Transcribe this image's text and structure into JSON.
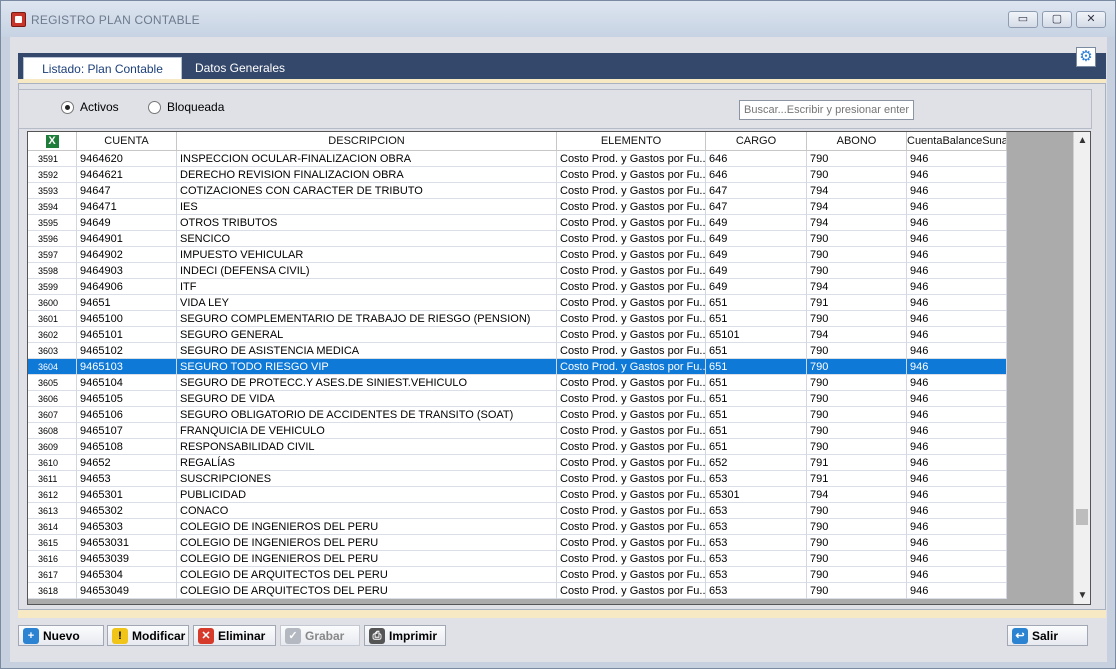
{
  "window": {
    "title": "REGISTRO PLAN CONTABLE",
    "controls": [
      "▭",
      "▢",
      "✕"
    ]
  },
  "tabs": [
    "Listado: Plan Contable",
    "Datos Generales"
  ],
  "filters": {
    "option1": "Activos",
    "option2": "Bloqueada",
    "search_placeholder": "Buscar...Escribir y presionar enter"
  },
  "grid": {
    "columns": [
      "",
      "CUENTA",
      "DESCRIPCION",
      "ELEMENTO",
      "CARGO",
      "ABONO",
      "CuentaBalanceSunat"
    ],
    "rows": [
      [
        "3591",
        "9464620",
        "INSPECCION OCULAR-FINALIZACION OBRA",
        "Costo Prod. y Gastos por Fu...",
        "646",
        "790",
        "946"
      ],
      [
        "3592",
        "9464621",
        "DERECHO REVISION FINALIZACION OBRA",
        "Costo Prod. y Gastos por Fu...",
        "646",
        "790",
        "946"
      ],
      [
        "3593",
        "94647",
        "COTIZACIONES CON CARACTER DE TRIBUTO",
        "Costo Prod. y Gastos por Fu...",
        "647",
        "794",
        "946"
      ],
      [
        "3594",
        "946471",
        "IES",
        "Costo Prod. y Gastos por Fu...",
        "647",
        "794",
        "946"
      ],
      [
        "3595",
        "94649",
        "OTROS TRIBUTOS",
        "Costo Prod. y Gastos por Fu...",
        "649",
        "794",
        "946"
      ],
      [
        "3596",
        "9464901",
        "SENCICO",
        "Costo Prod. y Gastos por Fu...",
        "649",
        "790",
        "946"
      ],
      [
        "3597",
        "9464902",
        "IMPUESTO VEHICULAR",
        "Costo Prod. y Gastos por Fu...",
        "649",
        "790",
        "946"
      ],
      [
        "3598",
        "9464903",
        "INDECI (DEFENSA CIVIL)",
        "Costo Prod. y Gastos por Fu...",
        "649",
        "790",
        "946"
      ],
      [
        "3599",
        "9464906",
        "ITF",
        "Costo Prod. y Gastos por Fu...",
        "649",
        "794",
        "946"
      ],
      [
        "3600",
        "94651",
        "VIDA LEY",
        "Costo Prod. y Gastos por Fu...",
        "651",
        "791",
        "946"
      ],
      [
        "3601",
        "9465100",
        "SEGURO COMPLEMENTARIO DE TRABAJO DE RIESGO (PENSION)",
        "Costo Prod. y Gastos por Fu...",
        "651",
        "790",
        "946"
      ],
      [
        "3602",
        "9465101",
        "SEGURO GENERAL",
        "Costo Prod. y Gastos por Fu...",
        "65101",
        "794",
        "946"
      ],
      [
        "3603",
        "9465102",
        "SEGURO DE ASISTENCIA MEDICA",
        "Costo Prod. y Gastos por Fu...",
        "651",
        "790",
        "946"
      ],
      [
        "3604",
        "9465103",
        "SEGURO TODO RIESGO VIP",
        "Costo Prod. y Gastos por Fu...",
        "651",
        "790",
        "946"
      ],
      [
        "3605",
        "9465104",
        "SEGURO DE PROTECC.Y ASES.DE SINIEST.VEHICULO",
        "Costo Prod. y Gastos por Fu...",
        "651",
        "790",
        "946"
      ],
      [
        "3606",
        "9465105",
        "SEGURO DE VIDA",
        "Costo Prod. y Gastos por Fu...",
        "651",
        "790",
        "946"
      ],
      [
        "3607",
        "9465106",
        "SEGURO OBLIGATORIO DE ACCIDENTES DE TRANSITO (SOAT)",
        "Costo Prod. y Gastos por Fu...",
        "651",
        "790",
        "946"
      ],
      [
        "3608",
        "9465107",
        "FRANQUICIA DE VEHICULO",
        "Costo Prod. y Gastos por Fu...",
        "651",
        "790",
        "946"
      ],
      [
        "3609",
        "9465108",
        "RESPONSABILIDAD CIVIL",
        "Costo Prod. y Gastos por Fu...",
        "651",
        "790",
        "946"
      ],
      [
        "3610",
        "94652",
        "REGALÍAS",
        "Costo Prod. y Gastos por Fu...",
        "652",
        "791",
        "946"
      ],
      [
        "3611",
        "94653",
        "SUSCRIPCIONES",
        "Costo Prod. y Gastos por Fu...",
        "653",
        "791",
        "946"
      ],
      [
        "3612",
        "9465301",
        "PUBLICIDAD",
        "Costo Prod. y Gastos por Fu...",
        "65301",
        "794",
        "946"
      ],
      [
        "3613",
        "9465302",
        "CONACO",
        "Costo Prod. y Gastos por Fu...",
        "653",
        "790",
        "946"
      ],
      [
        "3614",
        "9465303",
        "COLEGIO DE INGENIEROS DEL PERU",
        "Costo Prod. y Gastos por Fu...",
        "653",
        "790",
        "946"
      ],
      [
        "3615",
        "94653031",
        "COLEGIO DE INGENIEROS DEL PERU",
        "Costo Prod. y Gastos por Fu...",
        "653",
        "790",
        "946"
      ],
      [
        "3616",
        "94653039",
        "COLEGIO DE INGENIEROS DEL PERU",
        "Costo Prod. y Gastos por Fu...",
        "653",
        "790",
        "946"
      ],
      [
        "3617",
        "9465304",
        "COLEGIO DE ARQUITECTOS DEL PERU",
        "Costo Prod. y Gastos por Fu...",
        "653",
        "790",
        "946"
      ],
      [
        "3618",
        "94653049",
        "COLEGIO DE ARQUITECTOS DEL PERU",
        "Costo Prod. y Gastos por Fu...",
        "653",
        "790",
        "946"
      ]
    ],
    "selected_row": "3604"
  },
  "buttons": {
    "nuevo": "Nuevo",
    "modificar": "Modificar",
    "eliminar": "Eliminar",
    "grabar": "Grabar",
    "imprimir": "Imprimir",
    "salir": "Salir"
  }
}
